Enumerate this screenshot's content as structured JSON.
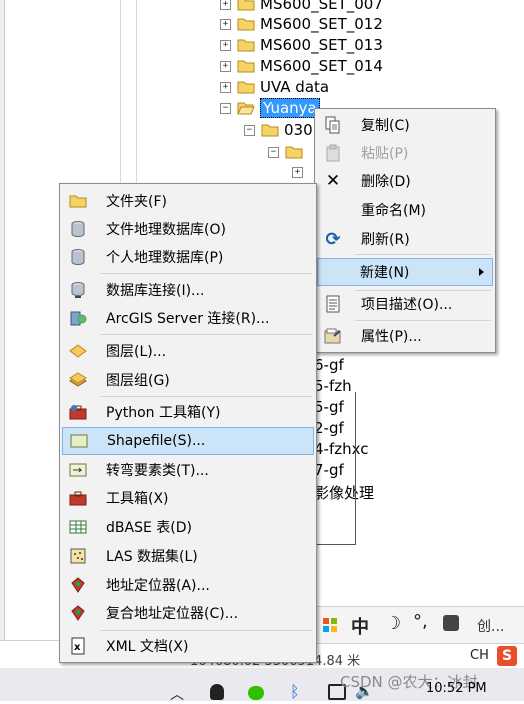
{
  "tree": {
    "items": [
      {
        "label": "MS600_SET_007"
      },
      {
        "label": "MS600_SET_012"
      },
      {
        "label": "MS600_SET_013"
      },
      {
        "label": "MS600_SET_014"
      },
      {
        "label": "UVA data"
      },
      {
        "label": "Yuanya"
      },
      {
        "label": "030"
      }
    ]
  },
  "background_list": [
    "6-gf",
    "5-fzh",
    "5-gf",
    "2-gf",
    "4-fzhxc",
    "7-gf",
    "影像处理"
  ],
  "context_menu": {
    "items": [
      {
        "label": "复制(C)",
        "icon": "copy-icon"
      },
      {
        "label": "粘贴(P)",
        "icon": "paste-icon",
        "disabled": true
      },
      {
        "label": "删除(D)",
        "icon": "delete-icon"
      },
      {
        "label": "重命名(M)",
        "icon": ""
      },
      {
        "label": "刷新(R)",
        "icon": "refresh-icon"
      },
      {
        "label": "新建(N)",
        "icon": "",
        "submenu": true
      },
      {
        "label": "项目描述(O)...",
        "icon": "item-description-icon"
      },
      {
        "label": "属性(P)...",
        "icon": "properties-icon"
      }
    ]
  },
  "new_submenu": {
    "items": [
      {
        "label": "文件夹(F)",
        "icon": "folder-icon"
      },
      {
        "label": "文件地理数据库(O)",
        "icon": "file-geodatabase-icon"
      },
      {
        "label": "个人地理数据库(P)",
        "icon": "personal-geodatabase-icon"
      },
      {
        "label": "数据库连接(I)...",
        "icon": "database-connection-icon"
      },
      {
        "label": "ArcGIS Server 连接(R)...",
        "icon": "arcgis-server-icon"
      },
      {
        "label": "图层(L)...",
        "icon": "layer-icon"
      },
      {
        "label": "图层组(G)",
        "icon": "layer-group-icon"
      },
      {
        "label": "Python 工具箱(Y)",
        "icon": "python-toolbox-icon"
      },
      {
        "label": "Shapefile(S)...",
        "icon": "shapefile-icon"
      },
      {
        "label": "转弯要素类(T)...",
        "icon": "turn-feature-class-icon"
      },
      {
        "label": "工具箱(X)",
        "icon": "toolbox-icon"
      },
      {
        "label": "dBASE 表(D)",
        "icon": "dbase-table-icon"
      },
      {
        "label": "LAS 数据集(L)",
        "icon": "las-dataset-icon"
      },
      {
        "label": "地址定位器(A)...",
        "icon": "address-locator-icon"
      },
      {
        "label": "复合地址定位器(C)...",
        "icon": "composite-address-locator-icon"
      },
      {
        "label": "XML 文档(X)",
        "icon": "xml-document-icon"
      }
    ]
  },
  "statusbar": {
    "coords": "164680.02 3306514.84 米"
  },
  "ime_toolbar": {
    "mode": "中",
    "create": "创..."
  },
  "taskbar": {
    "lang": "CH",
    "time": "10:52 PM",
    "watermark": "CSDN @农大：冰封"
  }
}
